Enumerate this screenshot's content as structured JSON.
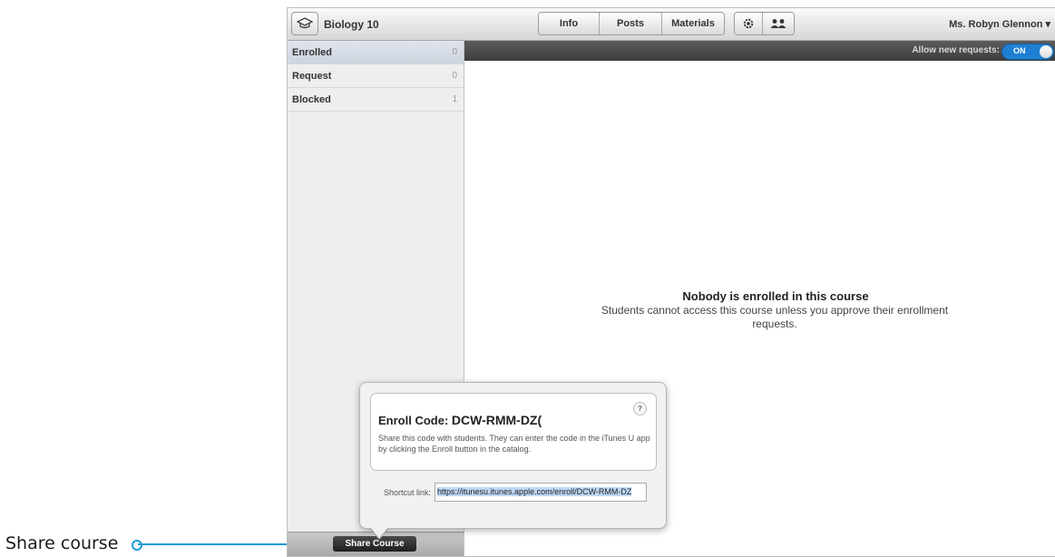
{
  "callout": {
    "label": "Share course"
  },
  "header": {
    "course_title": "Biology 10",
    "tabs": [
      {
        "label": "Info"
      },
      {
        "label": "Posts"
      },
      {
        "label": "Materials"
      }
    ],
    "icon_tabs": [
      {
        "icon": "gear-icon"
      },
      {
        "icon": "people-icon"
      }
    ],
    "user_menu": "Ms. Robyn Glennon ▾"
  },
  "sidebar": {
    "items": [
      {
        "label": "Enrolled",
        "count": "0",
        "selected": true
      },
      {
        "label": "Request",
        "count": "0"
      },
      {
        "label": "Blocked",
        "count": "1"
      }
    ],
    "share_button": "Share Course"
  },
  "main": {
    "allow_label": "Allow new requests:",
    "toggle_state": "ON",
    "empty_title": "Nobody is enrolled in this course",
    "empty_subtitle": "Students cannot access this course unless you approve their enrollment requests."
  },
  "popover": {
    "enroll_label": "Enroll Code:",
    "enroll_code": "DCW-RMM-DZ(",
    "help": "?",
    "description": "Share this code with students. They can enter the code in the iTunes U app by clicking the Enroll button in the catalog.",
    "shortcut_label": "Shortcut link:",
    "shortcut_url": "https://itunesu.itunes.apple.com/enroll/DCW-RMM-DZ"
  },
  "colors": {
    "accent": "#1e9ad6",
    "toggle": "#1f7fd3",
    "bar_dark": "#3d3d3d"
  }
}
